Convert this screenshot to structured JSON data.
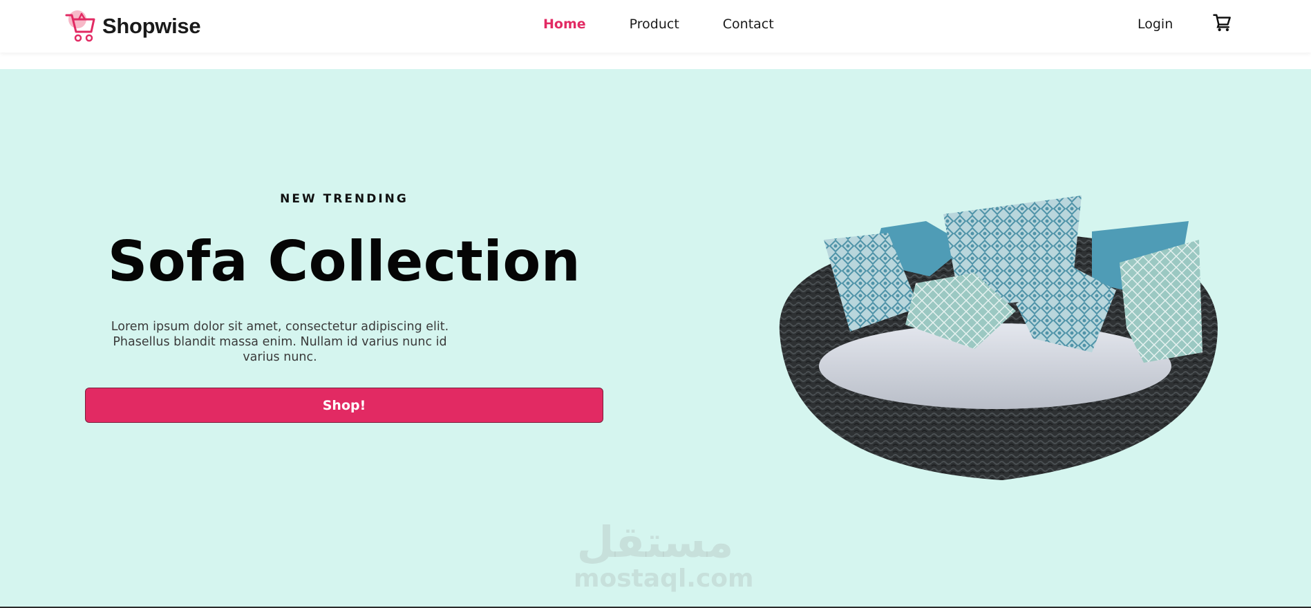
{
  "brand": {
    "name": "Shopwise",
    "logo_icon": "shopping-cart-logo-icon"
  },
  "nav": {
    "items": [
      {
        "label": "Home",
        "active": true
      },
      {
        "label": "Product",
        "active": false
      },
      {
        "label": "Contact",
        "active": false
      }
    ],
    "login_label": "Login",
    "cart_icon": "cart-icon"
  },
  "hero": {
    "kicker": "NEW TRENDING",
    "title": "Sofa Collection",
    "description": "Lorem ipsum dolor sit amet, consectetur adipiscing elit. Phasellus blandit massa enim. Nullam id varius nunc id varius nunc.",
    "cta_label": "Shop!",
    "image_subject": "round wicker daybed sofa with patterned pillows"
  },
  "watermark": {
    "arabic": "مستقل",
    "latin": "mostaql.com"
  },
  "colors": {
    "accent": "#e22a63",
    "hero_bg": "#d5f5ef",
    "text": "#111111"
  }
}
